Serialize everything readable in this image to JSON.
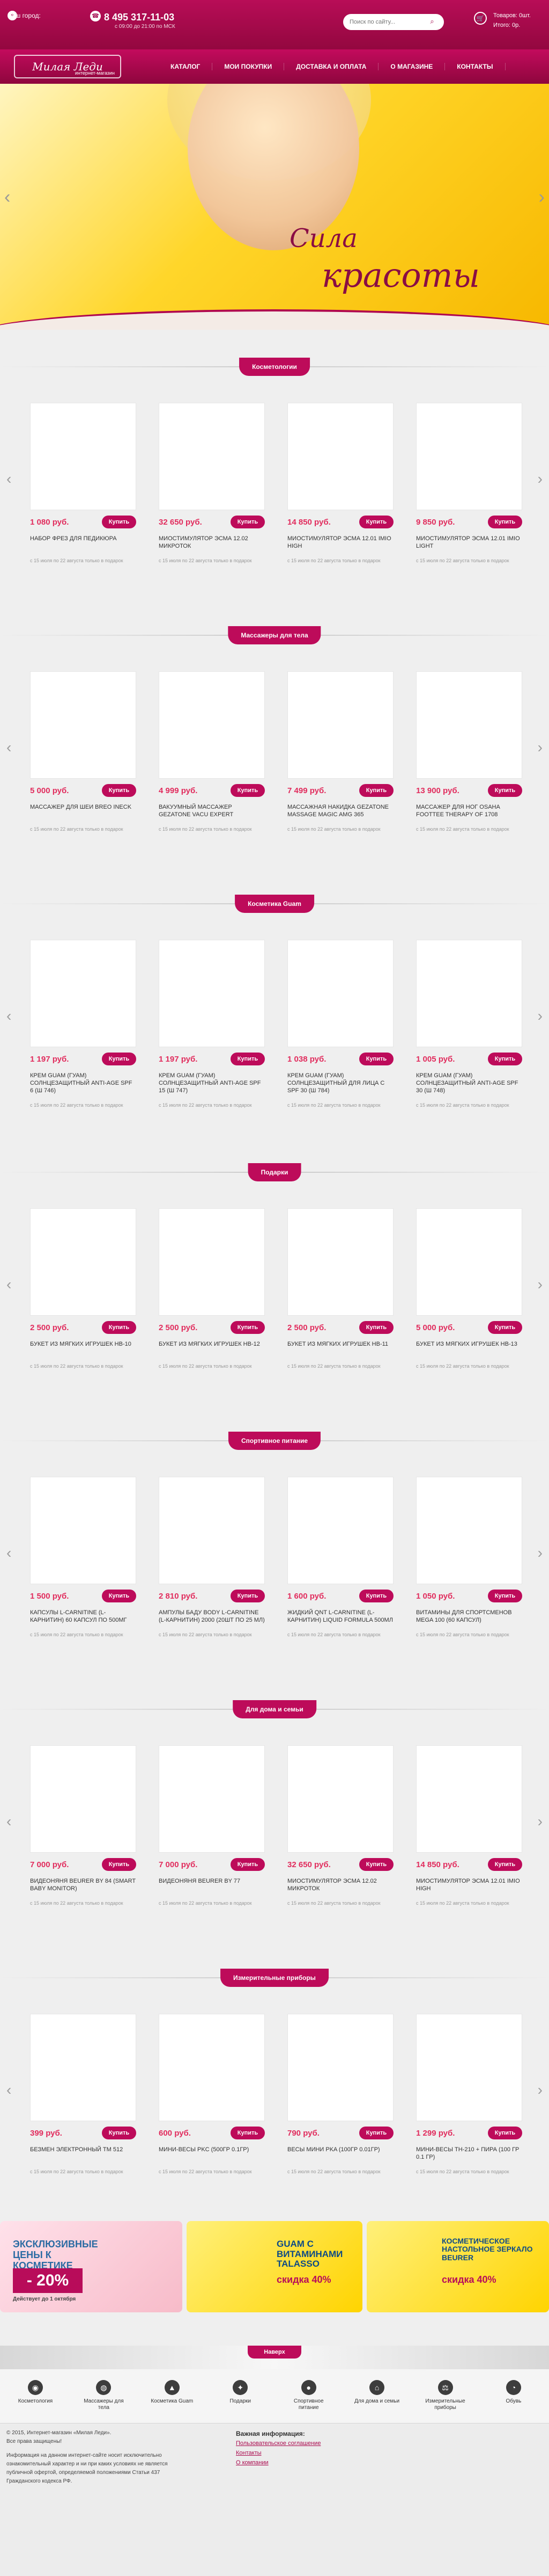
{
  "header": {
    "city_label": "Ваш город:",
    "phone": "8 495 317-11-03",
    "phone_note": "с 09:00 до 21:00 по МСК",
    "search_placeholder": "Поиск по сайту...",
    "cart_label": "Товаров:",
    "cart_count": "0",
    "cart_count_unit": "шт.",
    "total_label": "Итого:",
    "total_value": "0",
    "currency": "р."
  },
  "nav": {
    "logo_text": "Милая Леди",
    "logo_sub": "интернет-магазин",
    "items": [
      "КАТАЛОГ",
      "МОИ ПОКУПКИ",
      "ДОСТАВКА И ОПЛАТА",
      "О МАГАЗИНЕ",
      "КОНТАКТЫ"
    ]
  },
  "hero": {
    "slogan_line1": "Сила",
    "slogan_line2": "красоты",
    "dots": 12,
    "active_dot": 0
  },
  "sections": [
    {
      "title": "Косметологии",
      "items": [
        {
          "price": "1 080 руб.",
          "buy": "Купить",
          "name": "НАБОР ФРЕЗ ДЛЯ ПЕДИКЮРА",
          "note": "с 15 июля по 22 августа только в подарок"
        },
        {
          "price": "32 650 руб.",
          "buy": "Купить",
          "name": "МИОСТИМУЛЯТОР ЭСМА 12.02 МИКРОТОК",
          "note": "с 15 июля по 22 августа только в подарок"
        },
        {
          "price": "14 850 руб.",
          "buy": "Купить",
          "name": "МИОСТИМУЛЯТОР ЭСМА 12.01 IMIO HIGH",
          "note": "с 15 июля по 22 августа только в подарок"
        },
        {
          "price": "9 850 руб.",
          "buy": "Купить",
          "name": "МИОСТИМУЛЯТОР ЭСМА 12.01 IMIO LIGHT",
          "note": "с 15 июля по 22 августа только в подарок"
        }
      ]
    },
    {
      "title": "Массажеры для тела",
      "items": [
        {
          "price": "5 000 руб.",
          "buy": "Купить",
          "name": "МАССАЖЕР ДЛЯ ШЕИ BREO INECK",
          "note": "с 15 июля по 22 августа только в подарок"
        },
        {
          "price": "4 999 руб.",
          "buy": "Купить",
          "name": "ВАКУУМНЫЙ МАССАЖЕР GEZATONE VACU EXPERT",
          "note": "с 15 июля по 22 августа только в подарок"
        },
        {
          "price": "7 499 руб.",
          "buy": "Купить",
          "name": "МАССАЖНАЯ НАКИДКА GEZATONE MASSAGE MAGIC AMG 365",
          "note": "с 15 июля по 22 августа только в подарок"
        },
        {
          "price": "13 900 руб.",
          "buy": "Купить",
          "name": "МАССАЖЕР ДЛЯ НОГ OSAHA FOOTTEE THERAPY OF 1708",
          "note": "с 15 июля по 22 августа только в подарок"
        }
      ]
    },
    {
      "title": "Косметика Guam",
      "items": [
        {
          "price": "1 197 руб.",
          "buy": "Купить",
          "name": "КРЕМ GUAM (ГУАМ) СОЛНЦЕЗАЩИТНЫЙ ANTI-AGE SPF 6 (Ш 746)",
          "note": "с 15 июля по 22 августа только в подарок"
        },
        {
          "price": "1 197 руб.",
          "buy": "Купить",
          "name": "КРЕМ GUAM (ГУАМ) СОЛНЦЕЗАЩИТНЫЙ ANTI-AGE SPF 15 (Ш 747)",
          "note": "с 15 июля по 22 августа только в подарок"
        },
        {
          "price": "1 038 руб.",
          "buy": "Купить",
          "name": "КРЕМ GUAM (ГУАМ) СОЛНЦЕЗАЩИТНЫЙ ДЛЯ ЛИЦА С SPF 30 (Ш 784)",
          "note": "с 15 июля по 22 августа только в подарок"
        },
        {
          "price": "1 005 руб.",
          "buy": "Купить",
          "name": "КРЕМ GUAM (ГУАМ) СОЛНЦЕЗАЩИТНЫЙ ANTI-AGE SPF 30 (Ш 748)",
          "note": "с 15 июля по 22 августа только в подарок"
        }
      ]
    },
    {
      "title": "Подарки",
      "items": [
        {
          "price": "2 500 руб.",
          "buy": "Купить",
          "name": "БУКЕТ ИЗ МЯГКИХ ИГРУШЕК НВ-10",
          "note": "с 15 июля по 22 августа только в подарок"
        },
        {
          "price": "2 500 руб.",
          "buy": "Купить",
          "name": "БУКЕТ ИЗ МЯГКИХ ИГРУШЕК НВ-12",
          "note": "с 15 июля по 22 августа только в подарок"
        },
        {
          "price": "2 500 руб.",
          "buy": "Купить",
          "name": "БУКЕТ ИЗ МЯГКИХ ИГРУШЕК НВ-11",
          "note": "с 15 июля по 22 августа только в подарок"
        },
        {
          "price": "5 000 руб.",
          "buy": "Купить",
          "name": "БУКЕТ ИЗ МЯГКИХ ИГРУШЕК НВ-13",
          "note": "с 15 июля по 22 августа только в подарок"
        }
      ]
    },
    {
      "title": "Спортивное питание",
      "items": [
        {
          "price": "1 500 руб.",
          "buy": "Купить",
          "name": "КАПСУЛЫ L-CARNITINE (L-КАРНИТИН) 60 КАПСУЛ ПО 500МГ",
          "note": "с 15 июля по 22 августа только в подарок"
        },
        {
          "price": "2 810 руб.",
          "buy": "Купить",
          "name": "АМПУЛЫ БАДУ BODY L-CARNITINE (L-КАРНИТИН) 2000 (20ШТ ПО 25 МЛ)",
          "note": "с 15 июля по 22 августа только в подарок"
        },
        {
          "price": "1 600 руб.",
          "buy": "Купить",
          "name": "ЖИДКИЙ QNT L-CARNITINE (L-КАРНИТИН) LIQUID FORMULA 500МЛ",
          "note": "с 15 июля по 22 августа только в подарок"
        },
        {
          "price": "1 050 руб.",
          "buy": "Купить",
          "name": "ВИТАМИНЫ ДЛЯ СПОРТСМЕНОВ MEGA 100 (60 КАПСУЛ)",
          "note": "с 15 июля по 22 августа только в подарок"
        }
      ]
    },
    {
      "title": "Для дома и семьи",
      "items": [
        {
          "price": "7 000 руб.",
          "buy": "Купить",
          "name": "ВИДЕОНЯНЯ BEURER BY 84 (SMART BABY MONITOR)",
          "note": "с 15 июля по 22 августа только в подарок"
        },
        {
          "price": "7 000 руб.",
          "buy": "Купить",
          "name": "ВИДЕОНЯНЯ BEURER BY 77",
          "note": "с 15 июля по 22 августа только в подарок"
        },
        {
          "price": "32 650 руб.",
          "buy": "Купить",
          "name": "МИОСТИМУЛЯТОР ЭСМА 12.02 МИКРОТОК",
          "note": "с 15 июля по 22 августа только в подарок"
        },
        {
          "price": "14 850 руб.",
          "buy": "Купить",
          "name": "МИОСТИМУЛЯТОР ЭСМА 12.01 IMIO HIGH",
          "note": "с 15 июля по 22 августа только в подарок"
        }
      ]
    },
    {
      "title": "Измерительные приборы",
      "items": [
        {
          "price": "399 руб.",
          "buy": "Купить",
          "name": "БЕЗМЕН ЭЛЕКТРОННЫЙ ТМ 512",
          "note": "с 15 июля по 22 августа только в подарок"
        },
        {
          "price": "600 руб.",
          "buy": "Купить",
          "name": "МИНИ-ВЕСЫ PKC (500ГР 0.1ГР)",
          "note": "с 15 июля по 22 августа только в подарок"
        },
        {
          "price": "790 руб.",
          "buy": "Купить",
          "name": "ВЕСЫ МИНИ PKA (100ГР 0.01ГР)",
          "note": "с 15 июля по 22 августа только в подарок"
        },
        {
          "price": "1 299 руб.",
          "buy": "Купить",
          "name": "МИНИ-ВЕСЫ TH-210 + ПИРА (100 ГР 0.1 ГР)",
          "note": "с 15 июля по 22 августа только в подарок"
        }
      ]
    }
  ],
  "promos": [
    {
      "title": "ЭКСКЛЮЗИВНЫЕ ЦЕНЫ К КОСМЕТИКЕ",
      "discount": "- 20%",
      "note": "Действует до 1 октября"
    },
    {
      "title": "GUAM С ВИТАМИНАМИ TALASSO",
      "sub": "скидка 40%"
    },
    {
      "title": "КОСМЕТИЧЕСКОЕ НАСТОЛЬНОЕ ЗЕРКАЛО BEURER",
      "sub": "скидка 40%"
    }
  ],
  "bottom": {
    "label": "Наверх"
  },
  "categories": [
    {
      "icon": "chair",
      "label": "Косметология"
    },
    {
      "icon": "massage",
      "label": "Массажеры для тела"
    },
    {
      "icon": "cream",
      "label": "Косметика Guam"
    },
    {
      "icon": "gift",
      "label": "Подарки"
    },
    {
      "icon": "fitness",
      "label": "Спортивное питание"
    },
    {
      "icon": "home",
      "label": "Для дома и семьи"
    },
    {
      "icon": "scale",
      "label": "Измерительные приборы"
    },
    {
      "icon": "shoe",
      "label": "Обувь"
    }
  ],
  "footer": {
    "left_line1": "© 2015, Интернет-магазин «Милая Леди».",
    "left_line2": "Все права защищены!",
    "left_line3": "Информация на данном интернет-сайте носит исключительно ознакомительный характер и ни при каких условиях не является публичной офертой, определяемой положениями Статьи 437 Гражданского кодекса РФ.",
    "info_title": "Важная информация:",
    "links": [
      "Пользовательское соглашение",
      "Контакты",
      "О компании"
    ]
  }
}
